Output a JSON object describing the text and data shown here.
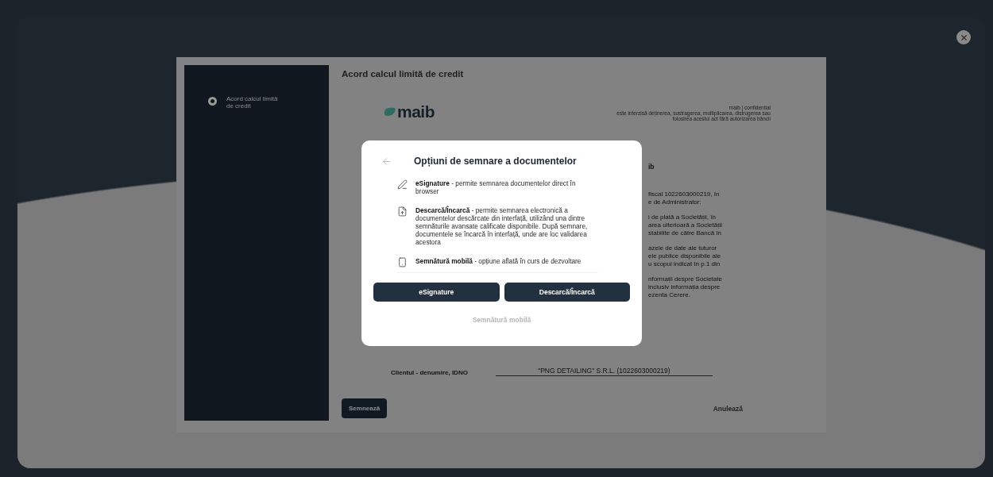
{
  "sidebar": {
    "steps": [
      {
        "label": "Acord calcul limită de credit",
        "selected": true
      }
    ]
  },
  "document": {
    "title": "Acord calcul limită de credit",
    "logo": "maib",
    "confidential": [
      "maib | confidential",
      "este interzisă deținerea, sustragerea, multiplicarea, distrugerea sau",
      "folosirea acestui act fără autorizarea băncii"
    ],
    "heading_fragment": "ib",
    "paragraph_fragments": [
      [
        "fiscal 1022603000219, în",
        "e de Administrator:"
      ],
      [
        "i de plată a Societății, în",
        "area ulterioară a Societății",
        "stabilite de către Bancă în"
      ],
      [
        "azele de date ale tuturor",
        "ele publice disponibile ale",
        "u scopul indicat în p.1 din"
      ],
      [
        "nformații despre Societate",
        "inclusiv informația despre",
        "ezenta Cerere."
      ]
    ],
    "signature": {
      "label": "Clientul - denumire, IDNO",
      "value": "\"PNG DETAILING\" S.R.L. (1022603000219)"
    },
    "sign_button": "Semnează",
    "cancel_button": "Anulează"
  },
  "modal": {
    "title": "Opțiuni de semnare a documentelor",
    "options": [
      {
        "kind": "pen",
        "text": "**eSignature** - permite semnarea documentelor direct în browser"
      },
      {
        "kind": "file",
        "text": "**Descarcă/Încarcă** - permite semnarea electronică a documentelor descărcate din interfață, utilizând una dintre semnăturile avansate calificate disponibile. După semnare, documentele se încarcă în interfață, unde are loc validarea acestora"
      },
      {
        "kind": "phone",
        "text": "**Semnătură mobilă** - opțiune aflată în curs de dezvoltare"
      }
    ],
    "buttons": [
      {
        "label": "eSignature",
        "disabled": false
      },
      {
        "label": "Descarcă/Încarcă",
        "disabled": false
      },
      {
        "label": "Semnătură mobilă",
        "disabled": true
      }
    ]
  }
}
